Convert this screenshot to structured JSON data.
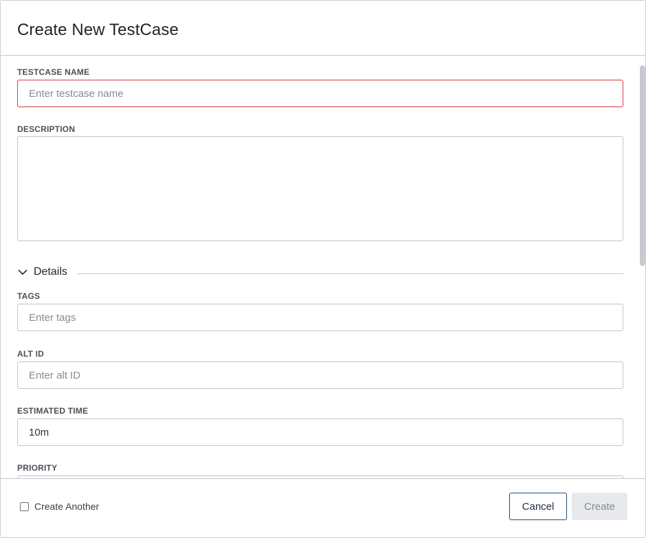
{
  "dialog": {
    "title": "Create New TestCase"
  },
  "fields": {
    "testcase_name": {
      "label": "TESTCASE NAME",
      "placeholder": "Enter testcase name",
      "value": ""
    },
    "description": {
      "label": "DESCRIPTION",
      "value": ""
    },
    "details_section": {
      "label": "Details",
      "expanded": true
    },
    "tags": {
      "label": "TAGS",
      "placeholder": "Enter tags",
      "value": ""
    },
    "alt_id": {
      "label": "ALT ID",
      "placeholder": "Enter alt ID",
      "value": ""
    },
    "estimated_time": {
      "label": "ESTIMATED TIME",
      "value": "10m"
    },
    "priority": {
      "label": "PRIORITY"
    }
  },
  "footer": {
    "create_another_label": "Create Another",
    "create_another_checked": false,
    "cancel_label": "Cancel",
    "create_label": "Create"
  },
  "colors": {
    "error_border": "#d73a3f",
    "cancel_border": "#1f4f78",
    "disabled_button_bg": "#e7e9ec"
  },
  "icons": {
    "details_toggle": "chevron-down-icon"
  }
}
